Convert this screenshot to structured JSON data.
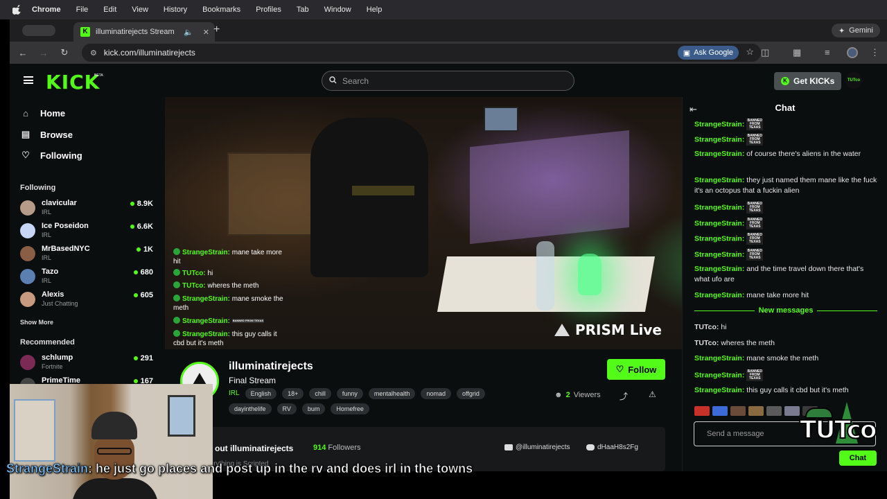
{
  "menubar": {
    "app": "Chrome",
    "items": [
      "File",
      "Edit",
      "View",
      "History",
      "Bookmarks",
      "Profiles",
      "Tab",
      "Window",
      "Help"
    ]
  },
  "browser": {
    "tab_title": "illuminatirejects Stream",
    "url": "kick.com/illuminatirejects",
    "ask_google": "Ask Google",
    "gemini": "Gemini"
  },
  "topbar": {
    "logo": "KICK",
    "logo_badge": "BETA",
    "search_placeholder": "Search",
    "get_kicks": "Get KICKs",
    "avatar_text": "TUTco"
  },
  "sidebar": {
    "nav": [
      "Home",
      "Browse",
      "Following"
    ],
    "following_header": "Following",
    "following": [
      {
        "name": "clavicular",
        "category": "IRL",
        "viewers": "8.9K"
      },
      {
        "name": "Ice Poseidon",
        "category": "IRL",
        "viewers": "6.6K"
      },
      {
        "name": "MrBasedNYC",
        "category": "IRL",
        "viewers": "1K"
      },
      {
        "name": "Tazo",
        "category": "IRL",
        "viewers": "680"
      },
      {
        "name": "Alexis",
        "category": "Just Chatting",
        "viewers": "605"
      }
    ],
    "show_more": "Show More",
    "recommended_header": "Recommended",
    "recommended": [
      {
        "name": "schlump",
        "category": "Fortnite",
        "viewers": "291"
      },
      {
        "name": "PrimeTime",
        "category": "",
        "viewers": "167"
      }
    ]
  },
  "video": {
    "watermark": "PRISM Live",
    "overlay": [
      {
        "user": "StrangeStrain:",
        "text": "mane take more hit"
      },
      {
        "user": "TUTco:",
        "text": "hi"
      },
      {
        "user": "TUTco:",
        "text": "wheres the meth"
      },
      {
        "user": "StrangeStrain:",
        "text": "mane smoke the meth"
      },
      {
        "user": "StrangeStrain:",
        "text": ""
      },
      {
        "user": "StrangeStrain:",
        "text": "this guy calls it cbd but it's meth"
      }
    ]
  },
  "channel": {
    "name": "illuminatirejects",
    "title": "Final Stream",
    "category": "IRL",
    "tags": [
      "English",
      "18+",
      "chill",
      "funny",
      "mentalhealth",
      "nomad",
      "offgrid",
      "dayinthelife",
      "RV",
      "bum",
      "Homefree"
    ],
    "follow_label": "Follow",
    "viewers_count": "2",
    "viewers_label": "Viewers",
    "about_title": "out illuminatirejects",
    "followers_count": "914",
    "followers_label": "Followers",
    "about_sub": "rything is Scripted",
    "youtube": "@illuminatirejects",
    "discord": "dHaaH8s2Fg"
  },
  "chat": {
    "title": "Chat",
    "banned_text": "BANNED FROM TEXAS",
    "messages": [
      {
        "user": "StrangeStrain:",
        "text": "",
        "banned": true
      },
      {
        "user": "StrangeStrain:",
        "text": "",
        "banned": true
      },
      {
        "user": "StrangeStrain:",
        "text": "of course there's aliens in the water"
      },
      {
        "user": "StrangeStrain:",
        "text": "they just named them mane like the fuck it's an octopus that a fuckin alien"
      },
      {
        "user": "StrangeStrain:",
        "text": "",
        "banned": true
      },
      {
        "user": "StrangeStrain:",
        "text": "",
        "banned": true
      },
      {
        "user": "StrangeStrain:",
        "text": "",
        "banned": true
      },
      {
        "user": "StrangeStrain:",
        "text": "",
        "banned": true
      },
      {
        "user": "StrangeStrain:",
        "text": "and the time travel down there that's what ufo are"
      },
      {
        "user": "StrangeStrain:",
        "text": "mane take more hit"
      }
    ],
    "new_messages_label": "New messages",
    "new_messages": [
      {
        "user": "TUTco:",
        "text": "hi"
      },
      {
        "user": "TUTco:",
        "text": "wheres the meth"
      },
      {
        "user": "StrangeStrain:",
        "text": "mane smoke the meth"
      },
      {
        "user": "StrangeStrain:",
        "text": "",
        "banned": true
      },
      {
        "user": "StrangeStrain:",
        "text": "this guy calls it cbd but it's meth"
      }
    ],
    "input_placeholder": "Send a message",
    "send_label": "Chat",
    "overlay_logo": "TUTco"
  },
  "caption": {
    "user": "StrangeStrain",
    "text": ": he just go places and post up in the rv and does irl in the towns"
  },
  "colors": {
    "kick_green": "#53fc18",
    "bg": "#0b0e0f"
  }
}
